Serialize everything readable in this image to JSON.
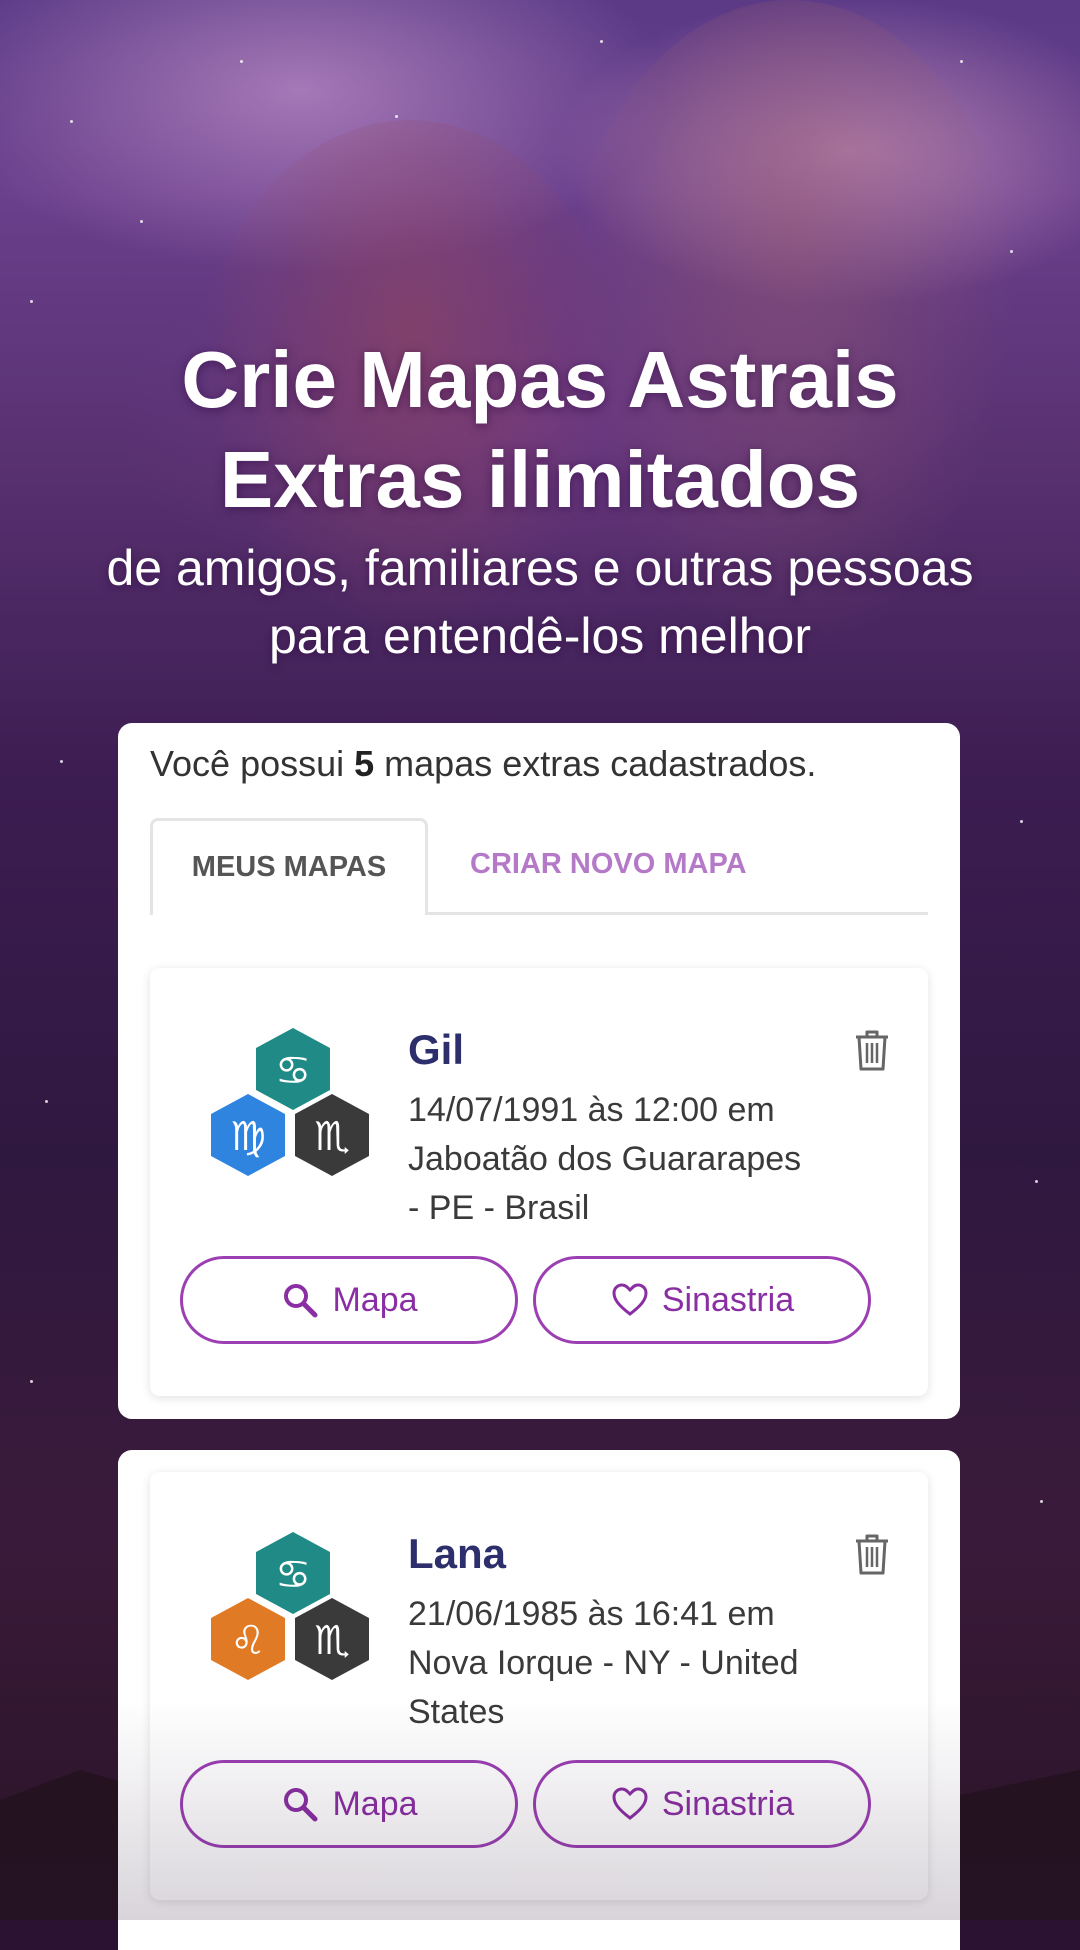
{
  "hero": {
    "title_line1": "Crie Mapas Astrais",
    "title_line2": "Extras ilimitados",
    "subtitle_line1": "de amigos, familiares e outras pessoas",
    "subtitle_line2": "para entendê-los melhor"
  },
  "summary": {
    "prefix": "Você possui ",
    "count": "5",
    "suffix": " mapas extras cadastrados."
  },
  "tabs": {
    "active": "MEUS MAPAS",
    "inactive": "CRIAR NOVO MAPA"
  },
  "charts": [
    {
      "name": "Gil",
      "date_line1": "14/07/1991 às 12:00 em",
      "date_line2": "Jaboatão dos Guararapes",
      "date_line3": "- PE - Brasil",
      "signs": [
        "cancer-icon",
        "virgo-icon",
        "scorpio-icon"
      ],
      "sign_colors": [
        "#1f8a86",
        "#2f84e0",
        "#3a3a3a"
      ],
      "map_label": "Mapa",
      "synastry_label": "Sinastria"
    },
    {
      "name": "Lana",
      "date_line1": "21/06/1985 às 16:41 em",
      "date_line2": "Nova Iorque - NY - United",
      "date_line3": "States",
      "signs": [
        "cancer-icon",
        "leo-icon",
        "scorpio-icon"
      ],
      "sign_colors": [
        "#1f8a86",
        "#e07a24",
        "#3a3a3a"
      ],
      "map_label": "Mapa",
      "synastry_label": "Sinastria"
    }
  ],
  "colors": {
    "accent": "#9b3fb3",
    "name": "#2c2f6b",
    "tab_inactive": "#b57ac7"
  }
}
